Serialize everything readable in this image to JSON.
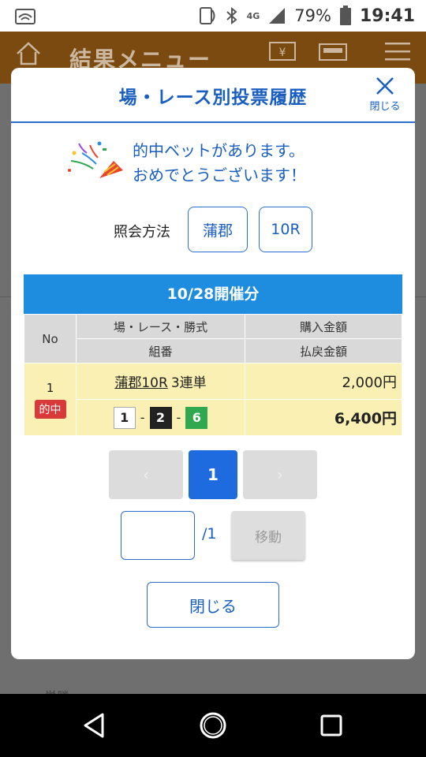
{
  "status": {
    "battery": "79%",
    "time": "19:41",
    "network": "4G"
  },
  "background": {
    "header_title": "結果メニュー",
    "peek_text": "単勝"
  },
  "modal": {
    "title": "場・レース別投票履歴",
    "close_icon_label": "閉じる",
    "congrats_line1": "的中ベットがあります。",
    "congrats_line2": "おめでとうございます！",
    "query_label": "照会方法",
    "query_venue": "蒲郡",
    "query_race": "10R",
    "results_header": "10/28開催分",
    "columns": {
      "no": "No",
      "venue_race_type": "場・レース・勝式",
      "purchase_amount": "購入金額",
      "combination": "組番",
      "payout_amount": "払戻金額"
    },
    "rows": [
      {
        "no": "1",
        "badge": "的中",
        "race": "蒲郡10R",
        "bet_type": "3連単",
        "combo": [
          "1",
          "2",
          "6"
        ],
        "combo_sep": "-",
        "purchase": "2,000円",
        "payout": "6,400円"
      }
    ],
    "pager": {
      "prev": "‹",
      "current": "1",
      "next": "›"
    },
    "jump": {
      "total": "/1",
      "move_label": "移動",
      "input_value": ""
    },
    "close_button": "閉じる"
  },
  "colors": {
    "accent": "#1a5fc0",
    "header_bar": "#1e8de0",
    "active_page": "#1e6be0",
    "hit_badge": "#d83a3a",
    "row_bg": "#fbf0b3"
  }
}
